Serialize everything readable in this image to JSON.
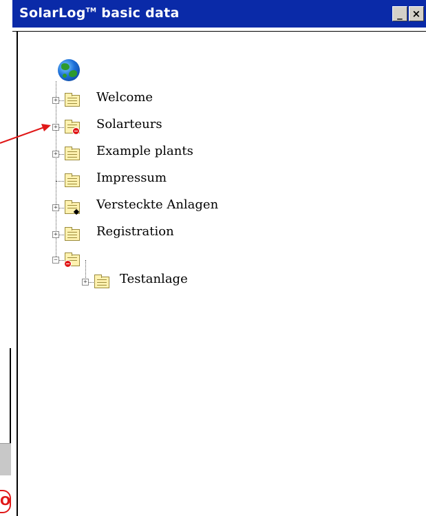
{
  "window": {
    "title": "SolarLog",
    "title_tm": "TM",
    "title_rest": " basic data",
    "min_glyph": "_",
    "close_glyph": "×",
    "titlebar_color": "#0a2aa8"
  },
  "tree": {
    "root_icon": "globe-icon",
    "items": [
      {
        "label": "Welcome",
        "expander": "+",
        "icon": "folder-icon"
      },
      {
        "label": "Solarteurs",
        "expander": "+",
        "icon": "folder-stop-icon"
      },
      {
        "label": "Example plants",
        "expander": "+",
        "icon": "folder-icon"
      },
      {
        "label": "Impressum",
        "expander": "",
        "icon": "folder-icon"
      },
      {
        "label": "Versteckte Anlagen",
        "expander": "+",
        "icon": "folder-pin-icon"
      },
      {
        "label": "Registration",
        "expander": "+",
        "icon": "folder-icon"
      },
      {
        "label": "",
        "expander": "−",
        "icon": "folder-stop-icon"
      }
    ],
    "child": {
      "label": "Testanlage",
      "expander": "+",
      "icon": "folder-icon"
    }
  },
  "colors": {
    "annotation_arrow": "#e01818",
    "folder_fill": "#fff2b0",
    "stop_badge": "#e01818"
  },
  "backdrop": {
    "badge_text": "O"
  }
}
